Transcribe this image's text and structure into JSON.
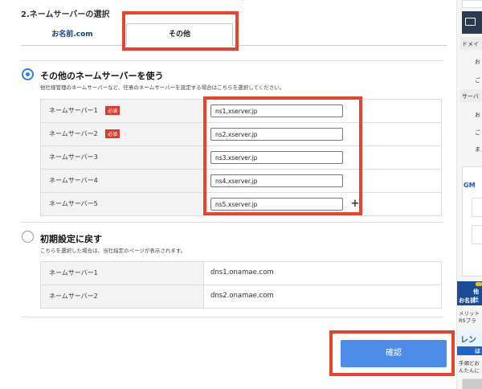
{
  "section": {
    "title": "2.ネームサーバーの選択"
  },
  "tabs": [
    {
      "label": "お名前.com",
      "active": false
    },
    {
      "label": "その他",
      "active": true
    }
  ],
  "other_ns_option": {
    "title": "その他のネームサーバーを使う",
    "description": "他社様管理のネームサーバーなど、任意のネームサーバーを設定する場合はこちらを選択してください。",
    "selected": true,
    "required_badge": "必須",
    "rows": [
      {
        "label": "ネームサーバー1",
        "required": true,
        "value": "ns1.xserver.jp"
      },
      {
        "label": "ネームサーバー2",
        "required": true,
        "value": "ns2.xserver.jp"
      },
      {
        "label": "ネームサーバー3",
        "required": false,
        "value": "ns3.xserver.jp"
      },
      {
        "label": "ネームサーバー4",
        "required": false,
        "value": "ns4.xserver.jp"
      },
      {
        "label": "ネームサーバー5",
        "required": false,
        "value": "ns5.xserver.jp"
      }
    ],
    "add_button": "+"
  },
  "default_ns_option": {
    "title": "初期設定に戻す",
    "description": "こちらを選択した場合は、当社指定のページが表示されます。",
    "selected": false,
    "rows": [
      {
        "label": "ネームサーバー1",
        "value": "dns1.onamae.com"
      },
      {
        "label": "ネームサーバー2",
        "value": "dns2.onamae.com"
      }
    ]
  },
  "confirm_button": {
    "label": "確認"
  },
  "sidebar": {
    "heading_fragment": "ドメイ",
    "items_a": [
      "お",
      "ご"
    ],
    "heading2_fragment": "サーバ",
    "items_b": [
      "お",
      "ご",
      "ま"
    ],
    "gm_fragment": "GM",
    "banner1_text": [
      "他社",
      "お名前",
      "メリット",
      "RSプラ"
    ],
    "banner2_text": [
      "レン",
      "は",
      "手順どお",
      "んたんに"
    ]
  },
  "colors": {
    "accent": "#2f7fe0",
    "button": "#4d8be8",
    "highlight_frame": "#e8432f",
    "required_badge": "#d83a2c"
  }
}
